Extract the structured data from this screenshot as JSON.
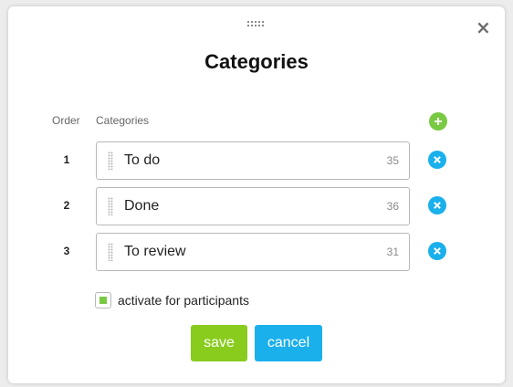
{
  "dialog": {
    "title": "Categories",
    "close_glyph": "×",
    "close_icon": "close-icon",
    "drag_icon": "drag-handle-icon"
  },
  "headers": {
    "order": "Order",
    "categories": "Categories"
  },
  "add_icon": "plus-icon",
  "rows": [
    {
      "order": "1",
      "label": "To do",
      "id": "35"
    },
    {
      "order": "2",
      "label": "Done",
      "id": "36"
    },
    {
      "order": "3",
      "label": "To review",
      "id": "31"
    }
  ],
  "participants": {
    "label": "activate for participants",
    "checked": true
  },
  "buttons": {
    "save": "save",
    "cancel": "cancel"
  },
  "colors": {
    "save": "#89cc1e",
    "cancel": "#1ab0ec",
    "add": "#7ac943",
    "remove": "#1ab0ec",
    "checkbox_fill": "#7ac943"
  }
}
